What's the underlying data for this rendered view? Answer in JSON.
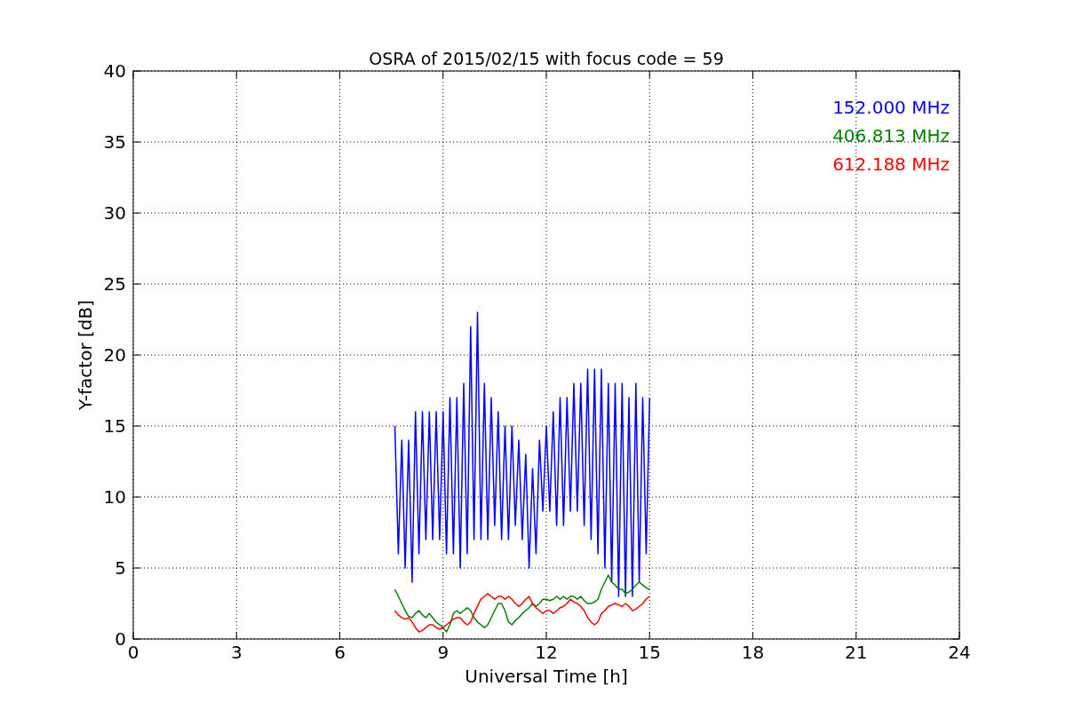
{
  "figure": {
    "chart_data": {
      "type": "line",
      "title": "OSRA of 2015/02/15 with focus code = 59",
      "xlabel": "Universal Time [h]",
      "ylabel": "Y-factor [dB]",
      "x": [
        7.6,
        7.7,
        7.8,
        7.9,
        8.0,
        8.1,
        8.2,
        8.3,
        8.4,
        8.5,
        8.6,
        8.7,
        8.8,
        8.9,
        9.0,
        9.1,
        9.2,
        9.3,
        9.4,
        9.5,
        9.6,
        9.7,
        9.8,
        9.9,
        10.0,
        10.1,
        10.2,
        10.3,
        10.4,
        10.5,
        10.6,
        10.7,
        10.8,
        10.9,
        11.0,
        11.1,
        11.2,
        11.3,
        11.4,
        11.5,
        11.6,
        11.7,
        11.8,
        11.9,
        12.0,
        12.1,
        12.2,
        12.3,
        12.4,
        12.5,
        12.6,
        12.7,
        12.8,
        12.9,
        13.0,
        13.1,
        13.2,
        13.3,
        13.4,
        13.5,
        13.6,
        13.7,
        13.8,
        13.9,
        14.0,
        14.1,
        14.2,
        14.3,
        14.4,
        14.5,
        14.6,
        14.7,
        14.8,
        14.9,
        15.0
      ],
      "series": [
        {
          "name": "152.000 MHz",
          "color": "#0000ff",
          "values": [
            15,
            6,
            14,
            5,
            14,
            4,
            16,
            6,
            16,
            7,
            16,
            7,
            16,
            7,
            16,
            6,
            17,
            6,
            17,
            5,
            18,
            6,
            22,
            7,
            23,
            7,
            18,
            7,
            17,
            8,
            16,
            7,
            15,
            7,
            15,
            8,
            14,
            7,
            13,
            5,
            12,
            6,
            14,
            9,
            15,
            9,
            16,
            8,
            17,
            8,
            17,
            9,
            18,
            9,
            18,
            8,
            19,
            7,
            19,
            6,
            19,
            5,
            18,
            4,
            18,
            3,
            18,
            3,
            17,
            3,
            18,
            4,
            17,
            6,
            17
          ]
        },
        {
          "name": "406.813 MHz",
          "color": "#008000",
          "values": [
            3.5,
            3.0,
            2.5,
            2.0,
            1.6,
            1.5,
            1.8,
            2.0,
            1.7,
            1.5,
            1.8,
            1.5,
            1.2,
            1.0,
            0.8,
            0.5,
            1.0,
            1.8,
            2.0,
            1.8,
            2.0,
            2.2,
            2.0,
            1.5,
            1.2,
            1.0,
            0.8,
            1.0,
            1.5,
            2.0,
            2.5,
            2.5,
            2.0,
            1.2,
            1.0,
            1.3,
            1.5,
            1.8,
            2.0,
            2.2,
            2.5,
            2.3,
            2.5,
            2.8,
            2.8,
            2.7,
            2.8,
            3.0,
            2.8,
            3.0,
            2.8,
            3.0,
            3.0,
            2.8,
            3.0,
            2.7,
            2.5,
            2.5,
            2.6,
            2.8,
            3.5,
            4.0,
            4.5,
            4.0,
            3.8,
            3.5,
            3.5,
            3.2,
            3.3,
            3.5,
            3.8,
            4.0,
            3.8,
            3.6,
            3.5
          ]
        },
        {
          "name": "612.188 MHz",
          "color": "#ff0000",
          "values": [
            2.0,
            1.7,
            1.5,
            1.4,
            1.5,
            1.2,
            0.8,
            0.5,
            0.6,
            0.8,
            1.0,
            1.0,
            0.8,
            0.7,
            0.8,
            1.0,
            1.2,
            1.4,
            1.5,
            1.5,
            1.2,
            1.0,
            1.2,
            1.8,
            2.3,
            2.8,
            3.0,
            3.2,
            3.0,
            2.8,
            3.0,
            3.0,
            2.8,
            3.0,
            2.8,
            2.5,
            2.3,
            2.5,
            2.8,
            3.0,
            2.5,
            2.2,
            2.0,
            1.8,
            2.0,
            2.0,
            1.8,
            2.0,
            2.2,
            2.3,
            2.5,
            2.8,
            2.6,
            2.5,
            2.3,
            2.0,
            1.5,
            1.2,
            1.0,
            1.2,
            1.8,
            2.0,
            2.3,
            2.4,
            2.5,
            2.4,
            2.3,
            2.5,
            2.3,
            2.0,
            2.1,
            2.3,
            2.5,
            2.8,
            3.0
          ]
        }
      ],
      "grid": true,
      "xlim": [
        0,
        24
      ],
      "ylim": [
        0,
        40
      ],
      "xticks": [
        0,
        3,
        6,
        9,
        12,
        15,
        18,
        21,
        24
      ],
      "yticks": [
        0,
        5,
        10,
        15,
        20,
        25,
        30,
        35,
        40
      ]
    }
  }
}
